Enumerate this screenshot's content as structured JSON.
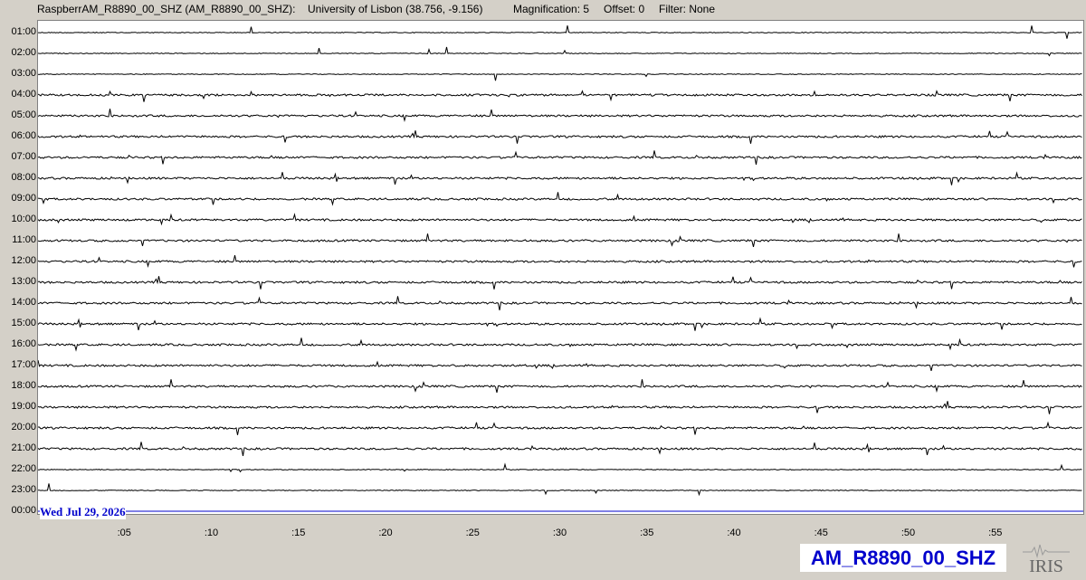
{
  "header": {
    "station": "RaspberrAM_R8890_00_SHZ (AM_R8890_00_SHZ):",
    "location": "University of Lisbon (38.756, -9.156)",
    "magnification": "Magnification: 5",
    "offset": "Offset: 0",
    "filter": "Filter: None"
  },
  "hour_labels": [
    "01:00",
    "02:00",
    "03:00",
    "04:00",
    "05:00",
    "06:00",
    "07:00",
    "08:00",
    "09:00",
    "10:00",
    "11:00",
    "12:00",
    "13:00",
    "14:00",
    "15:00",
    "16:00",
    "17:00",
    "18:00",
    "19:00",
    "20:00",
    "21:00",
    "22:00",
    "23:00",
    "00:00"
  ],
  "minute_labels": [
    ":05",
    ":10",
    ":15",
    ":20",
    ":25",
    ":30",
    ":35",
    ":40",
    ":45",
    ":50",
    ":55"
  ],
  "date_label": "Wed Jul 29, 2026",
  "station_badge": "AM_R8890_00_SHZ",
  "logo_text": "IRIS",
  "colors": {
    "trace": "#000000",
    "current_line": "#0000cc",
    "badge_text": "#0000cc",
    "background": "#d4d0c8"
  }
}
